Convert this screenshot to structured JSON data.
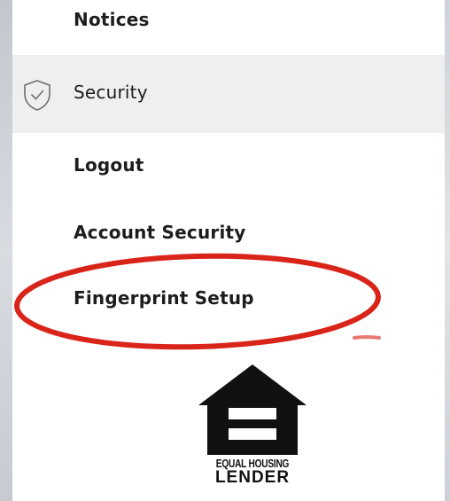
{
  "menu": {
    "items": [
      {
        "label": "Notices"
      },
      {
        "label": "Security",
        "icon": "shield-check-icon"
      },
      {
        "label": "Logout"
      },
      {
        "label": "Account Security"
      },
      {
        "label": "Fingerprint Setup"
      }
    ]
  },
  "logo": {
    "line1": "EQUAL HOUSING",
    "line2": "LENDER"
  },
  "colors": {
    "highlight_row": "#efefef",
    "annotation_circle": "#d9241a"
  }
}
